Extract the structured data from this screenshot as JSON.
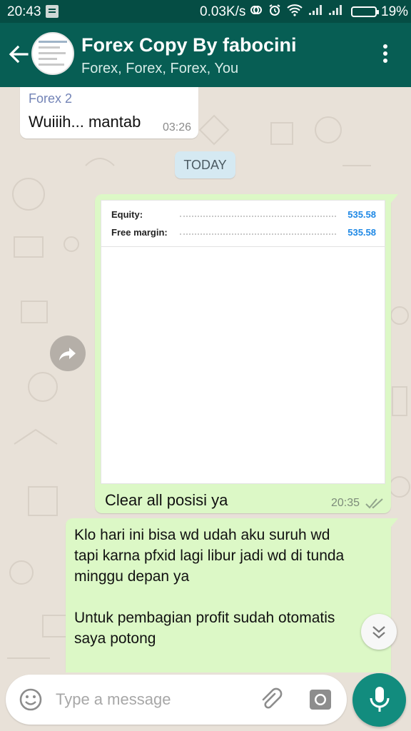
{
  "status_bar": {
    "time": "20:43",
    "net_speed": "0.03K/s",
    "battery_pct": "19%"
  },
  "header": {
    "title": "Forex Copy By fabocini",
    "subtitle": "Forex, Forex, Forex, You"
  },
  "messages": {
    "incoming": {
      "sender": "Forex 2",
      "text": "Wuiiih... mantab",
      "time": "03:26"
    },
    "date_divider": "TODAY",
    "image_message": {
      "rows": [
        {
          "label": "Equity:",
          "value": "535.58"
        },
        {
          "label": "Free margin:",
          "value": "535.58"
        }
      ],
      "caption": "Clear all posisi ya",
      "time": "20:35"
    },
    "text_message": {
      "lines": [
        "Klo hari ini bisa wd udah aku suruh wd",
        "tapi karna pfxid lagi libur jadi wd di tunda",
        "minggu depan ya",
        "",
        "Untuk pembagian profit sudah otomatis",
        "saya potong"
      ]
    }
  },
  "composer": {
    "placeholder": "Type a message"
  },
  "colors": {
    "app_bar": "#075e54",
    "status_bar": "#054d44",
    "outgoing_bubble": "#dcf8c6",
    "accent": "#128c7e",
    "value_blue": "#1e88e5"
  },
  "icons": [
    "back-arrow-icon",
    "more-vert-icon",
    "forward-icon",
    "double-check-icon",
    "chevron-down-icon",
    "emoji-icon",
    "attach-icon",
    "camera-icon",
    "mic-icon"
  ]
}
